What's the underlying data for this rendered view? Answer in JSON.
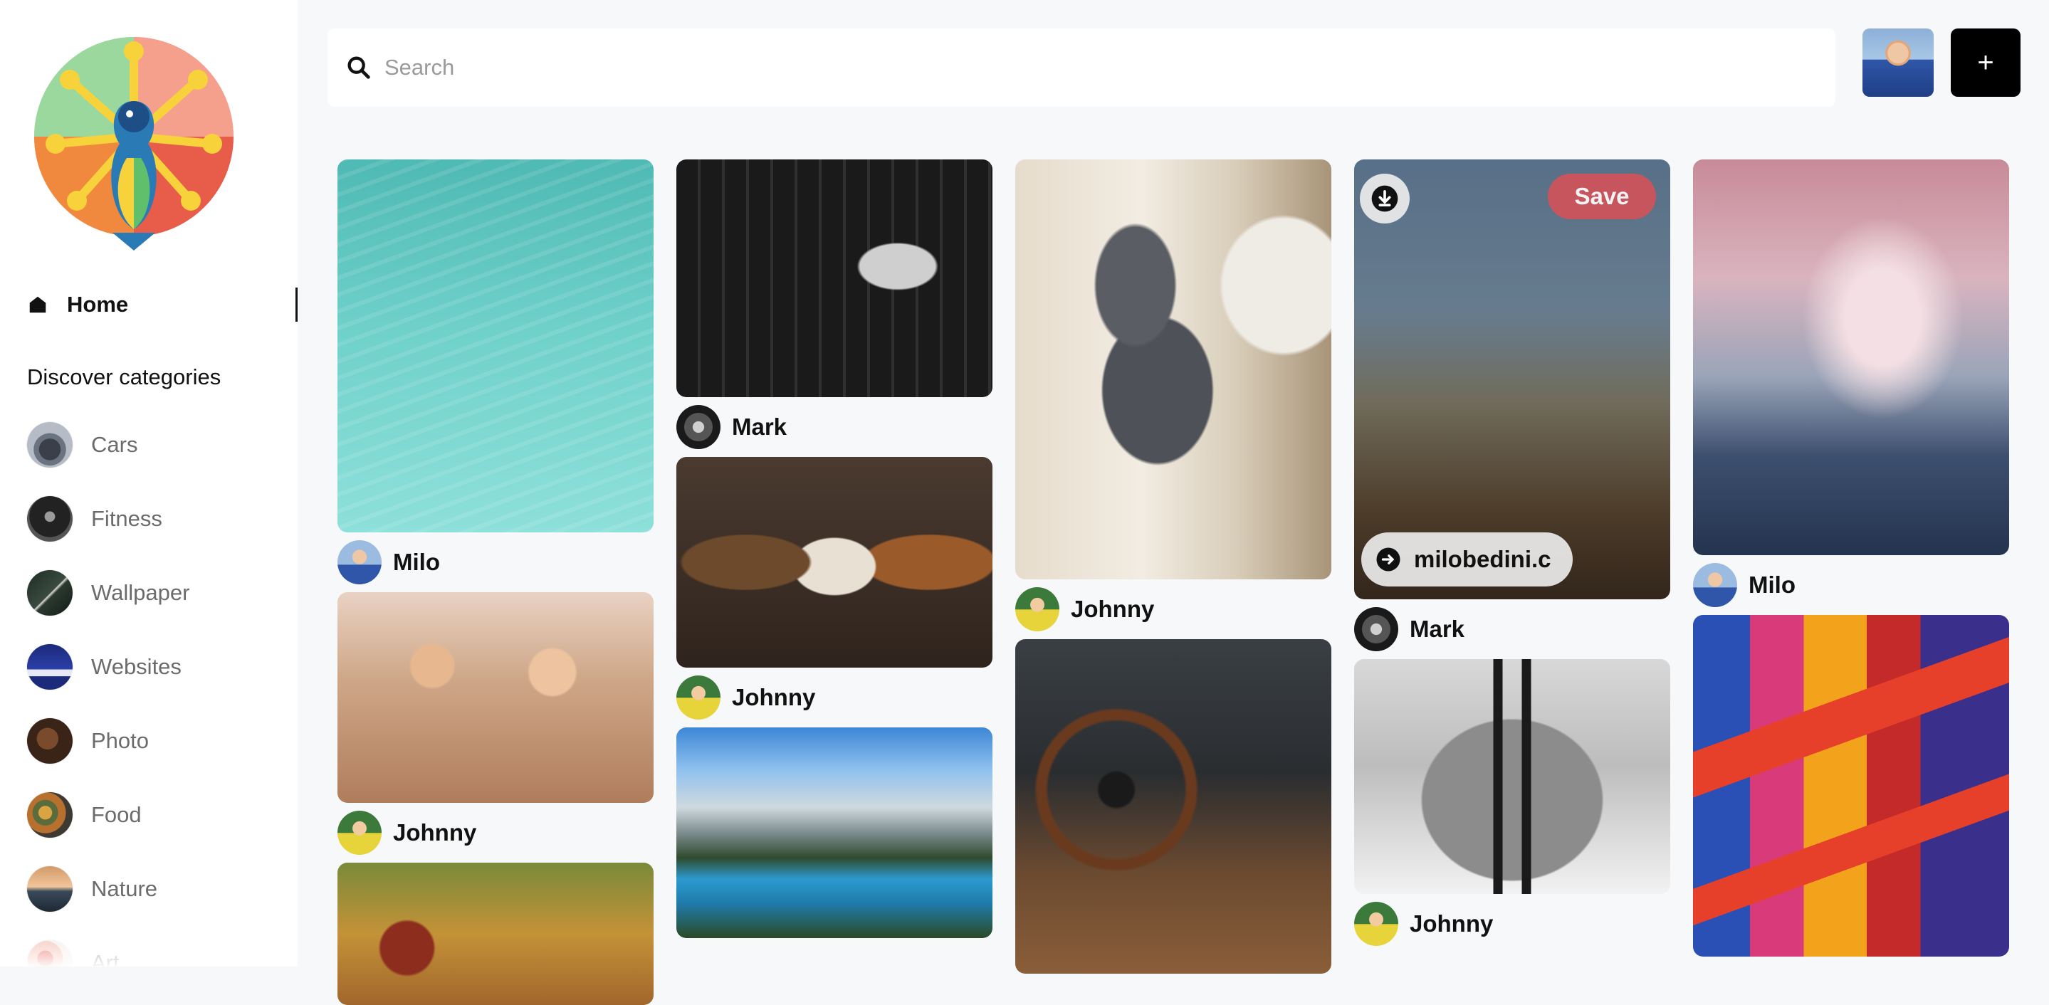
{
  "sidebar": {
    "home_label": "Home",
    "discover_title": "Discover categories",
    "categories": [
      {
        "label": "Cars",
        "icon": "cars-thumbnail"
      },
      {
        "label": "Fitness",
        "icon": "fitness-thumbnail"
      },
      {
        "label": "Wallpaper",
        "icon": "wallpaper-thumbnail"
      },
      {
        "label": "Websites",
        "icon": "websites-thumbnail"
      },
      {
        "label": "Photo",
        "icon": "photo-thumbnail"
      },
      {
        "label": "Food",
        "icon": "food-thumbnail"
      },
      {
        "label": "Nature",
        "icon": "nature-thumbnail"
      },
      {
        "label": "Art",
        "icon": "art-thumbnail"
      }
    ]
  },
  "search": {
    "placeholder": "Search",
    "value": ""
  },
  "header": {
    "create_label": "+"
  },
  "feed": {
    "save_label": "Save",
    "source_link": "milobedini.c",
    "authors": {
      "col1": [
        "Milo",
        "Johnny"
      ],
      "col2": [
        "Mark",
        "Johnny"
      ],
      "col3": [
        "Johnny"
      ],
      "col4": [
        "Mark",
        "Johnny"
      ],
      "col5": [
        "Milo"
      ]
    }
  },
  "colors": {
    "accent_save": "#d1535a",
    "create_button_bg": "#000000",
    "background": "#f7f8fa"
  }
}
